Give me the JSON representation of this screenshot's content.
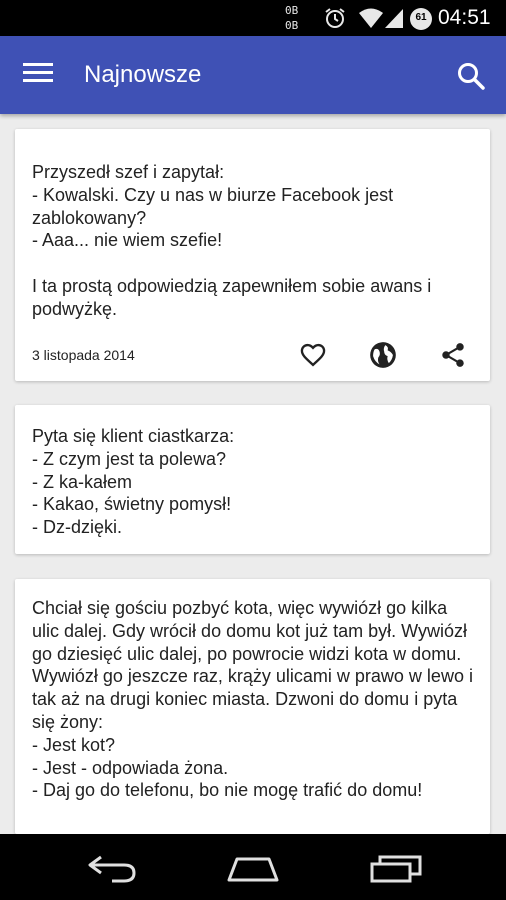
{
  "status_bar": {
    "net_down": "0B",
    "net_up": "0B",
    "battery_level": "61",
    "time": "04:51",
    "icons": [
      "alarm-icon",
      "wifi-icon",
      "signal-icon",
      "battery-icon"
    ]
  },
  "app_bar": {
    "title": "Najnowsze",
    "menu_icon": "hamburger-menu-icon",
    "search_icon": "search-icon",
    "color": "#3f51b5"
  },
  "posts": [
    {
      "text": "Przyszedł szef i zapytał:\n- Kowalski. Czy u nas w biurze Facebook jest zablokowany?\n- Aaa... nie wiem szefie!\n\nI ta prostą odpowiedzią zapewniłem sobie awans i podwyżkę.",
      "date": "3 listopada 2014",
      "actions": [
        "heart-icon",
        "globe-icon",
        "share-icon"
      ]
    },
    {
      "text": "Pyta się klient ciastkarza:\n- Z czym jest ta polewa?\n- Z ka-kałem\n- Kakao, świetny pomysł!\n- Dz-dzięki."
    },
    {
      "text": "Chciał się gościu pozbyć kota, więc wywiózł go kilka ulic dalej. Gdy wrócił do domu kot już tam był. Wywiózł go dziesięć ulic dalej, po powrocie widzi kota w domu. Wywiózł go jeszcze raz, krąży ulicami w prawo w lewo i tak aż na drugi koniec miasta. Dzwoni do domu i pyta się żony:\n- Jest kot?\n- Jest - odpowiada żona.\n- Daj go do telefonu, bo nie mogę trafić do domu!"
    }
  ],
  "nav_bar": {
    "icons": [
      "back-icon",
      "home-icon",
      "recent-apps-icon"
    ]
  }
}
